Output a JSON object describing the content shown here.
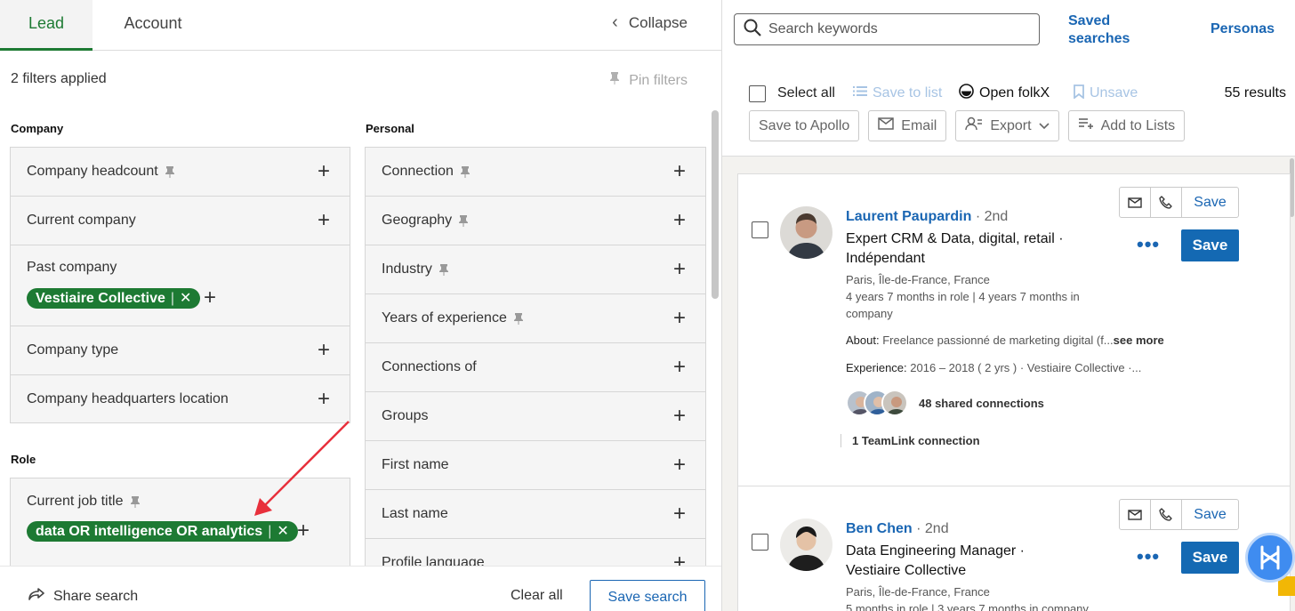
{
  "tabs": {
    "lead": "Lead",
    "account": "Account",
    "collapse": "Collapse"
  },
  "filters": {
    "applied": "2 filters applied",
    "pin_filters": "Pin filters",
    "company_title": "Company",
    "personal_title": "Personal",
    "role_title": "Role",
    "company": [
      "Company headcount",
      "Current company",
      "Past company",
      "Company type",
      "Company headquarters location"
    ],
    "personal": [
      "Connection",
      "Geography",
      "Industry",
      "Years of experience",
      "Connections of",
      "Groups",
      "First name",
      "Last name",
      "Profile language"
    ],
    "role": [
      "Current job title"
    ],
    "past_company_chip": "Vestiaire Collective",
    "job_title_chip": "data OR intelligence OR analytics"
  },
  "bottom": {
    "share": "Share search",
    "clear": "Clear all",
    "save": "Save search"
  },
  "topbar": {
    "search_placeholder": "Search keywords",
    "saved_searches_1": "Saved",
    "saved_searches_2": "searches",
    "personas": "Personas"
  },
  "actions": {
    "select_all": "Select all",
    "save_to_list": "Save to list",
    "open_folkx": "Open folkX",
    "unsave": "Unsave",
    "results": "55 results",
    "save_to_apollo": "Save to Apollo",
    "email": "Email",
    "export": "Export",
    "add_to_lists": "Add to Lists"
  },
  "leads": [
    {
      "name": "Laurent Paupardin",
      "degree": "· 2nd",
      "title_1": "Expert CRM & Data, digital, retail ·",
      "title_2": "Indépendant",
      "location": "Paris, Île-de-France, France",
      "tenure_1": "4 years 7 months in role | 4 years 7 months in",
      "tenure_2": "company",
      "about_label": "About:",
      "about": "Freelance passionné de marketing digital (f...",
      "see_more": "see more",
      "exp_label": "Experience:",
      "exp": "2016 – 2018  ( 2 yrs ) · Vestiaire Collective ·...",
      "shared": "48 shared connections",
      "teamlink": "1 TeamLink connection",
      "save_small": "Save",
      "save": "Save",
      "dots": "•••"
    },
    {
      "name": "Ben Chen",
      "degree": "· 2nd",
      "title_1": "Data Engineering Manager ·",
      "title_2": "Vestiaire Collective",
      "location": "Paris, Île-de-France, France",
      "tenure_1": "5 months in role | 3 years 7 months in company",
      "save_small": "Save",
      "save": "Save",
      "dots": "•••"
    }
  ],
  "colors": {
    "accent_green": "#1d7a33",
    "link_blue": "#1a66b3",
    "save_blue": "#1469b3",
    "annotation_arrow": "#e8303c"
  }
}
